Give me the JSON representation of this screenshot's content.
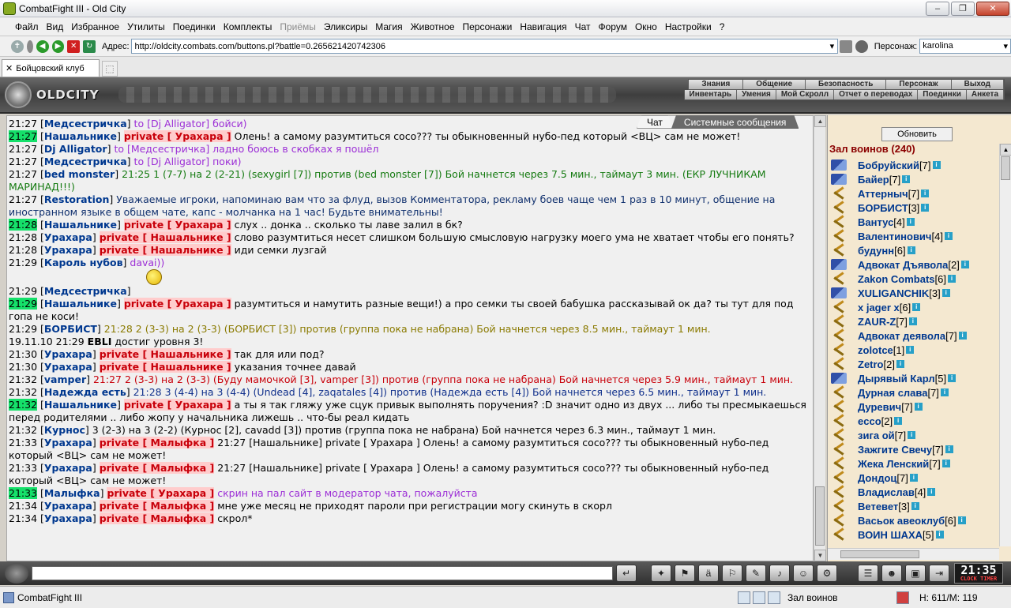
{
  "window": {
    "title": "CombatFight III - Old City"
  },
  "menu": [
    "Файл",
    "Вид",
    "Избранное",
    "Утилиты",
    "Поединки",
    "Комплекты",
    "Приёмы",
    "Эликсиры",
    "Магия",
    "Животное",
    "Персонажи",
    "Навигация",
    "Чат",
    "Форум",
    "Окно",
    "Настройки",
    "?"
  ],
  "menu_disabled_index": 6,
  "address": {
    "label": "Адрес:",
    "url": "http://oldcity.combats.com/buttons.pl?battle=0.265621420742306",
    "persona_label": "Персонаж:",
    "persona": "karolina"
  },
  "tab": {
    "label": "Бойцовский клуб"
  },
  "logo": {
    "text": "OLDCITY"
  },
  "topnav1": [
    "Знания",
    "Общение",
    "Безопасность",
    "Персонаж",
    "Выход"
  ],
  "topnav2": [
    "Инвентарь",
    "Умения",
    "Мой Скролл",
    "Отчет о переводах",
    "Поединки",
    "Анкета"
  ],
  "chat_tabs": {
    "active": "Чат",
    "other": "Системные сообщения"
  },
  "chat": [
    {
      "time": "21:27",
      "hl": false,
      "nick": "Медсестричка",
      "to": "to [Dj Alligator] бойси)"
    },
    {
      "time": "21:27",
      "hl": true,
      "nick": "Нашальнике",
      "priv": "private [ Урахара ]",
      "text": " Олень! а самому разумтиться сосо??? ты обыкновенный нубо-пед который <ВЦ> сам не может!"
    },
    {
      "time": "21:27",
      "hl": false,
      "nick": "Dj Alligator",
      "to": "to [Медсестричка] ладно боюсь в скобках я пошёл"
    },
    {
      "time": "21:27",
      "hl": false,
      "nick": "Медсестричка",
      "to": "to [Dj Alligator] поки)"
    },
    {
      "time": "21:27",
      "hl": false,
      "nick": "bed monster",
      "sys": "21:25 1 (7-7) на 2 (2-21) (sexygirl [7]) против (bed monster [7]) Бой начнется через 7.5 мин., таймаут 3 мин. (ЕКР ЛУЧНИКАМ МАРИНАД!!!)"
    },
    {
      "time": "21:27",
      "hl": false,
      "nick": "Restoration",
      "info": " Уважаемые игроки, напоминаю вам что за флуд, вызов Комментатора, рекламу боев чаще чем 1 раз в 10 минут, общение на иностранном языке в общем чате, капс - молчанка на 1 час! Будьте внимательны!"
    },
    {
      "time": "21:28",
      "hl": true,
      "nick": "Нашальнике",
      "priv": "private [ Урахара ]",
      "text": " слух .. донка .. сколько ты лаве залил в бк?"
    },
    {
      "time": "21:28",
      "hl": false,
      "nick": "Урахара",
      "priv": "private [ Нашальнике ]",
      "text": " слово разумтиться несет слишком большую смысловую нагрузку моего ума не хватает чтобы его понять?"
    },
    {
      "time": "21:28",
      "hl": false,
      "nick": "Урахара",
      "priv": "private [ Нашальнике ]",
      "text": " иди семки лузгай"
    },
    {
      "time": "21:29",
      "hl": false,
      "nick": "Кароль нубов",
      "to": "davai))",
      "smiley": true
    },
    {
      "time": "21:29",
      "hl": false,
      "nick": "Медсестричка",
      "text": " "
    },
    {
      "time": "21:29",
      "hl": true,
      "nick": "Нашальнике",
      "priv": "private [ Урахара ]",
      "text": " разумтиться и намутить разные вещи!) а про семки ты своей бабушка рассказывай ок да? ты тут для под гопа не коси!"
    },
    {
      "time": "21:29",
      "hl": false,
      "nick": "БОРБИСТ",
      "sys2": "21:28 2 (3-3) на 2 (3-3) (БОРБИСТ [3]) против (группа пока не набрана) Бой начнется через 8.5 мин., таймаут 1 мин."
    },
    {
      "time": "19.11.10  21:29",
      "hl": false,
      "plain": "EBLI",
      "text": " достиг уровня 3!"
    },
    {
      "time": "21:30",
      "hl": false,
      "nick": "Урахара",
      "priv": "private [ Нашальнике ]",
      "text": " так для или под?"
    },
    {
      "time": "21:30",
      "hl": false,
      "nick": "Урахара",
      "priv": "private [ Нашальнике ]",
      "text": " указания точнее давай"
    },
    {
      "time": "21:32",
      "hl": false,
      "nick": "vamper",
      "sys3": "21:27 2 (3-3) на 2 (3-3) (Буду мамочкой [3], vamper [3]) против (группа пока не набрана) Бой начнется через 5.9 мин., таймаут 1 мин."
    },
    {
      "time": "21:32",
      "hl": false,
      "nick": "Надежда есть",
      "sys4": "21:28 3 (4-4) на 3 (4-4) (Undead [4], zaqatales [4]) против (Надежда есть [4]) Бой начнется через 6.5 мин., таймаут 1 мин."
    },
    {
      "time": "21:32",
      "hl": true,
      "nick": "Нашальнике",
      "priv": "private [ Урахара ]",
      "text": " а ты я так гляжу уже сцук привык выполнять поручения? :D значит одно из двух ... либо ты пресмыкаешься перед родителями .. либо жопу у начальника лижешь .. что-бы реал кидать"
    },
    {
      "time": "21:32",
      "hl": false,
      "nick": "Курнос",
      "text": " 3 (2-3) на 3 (2-2) (Курнос [2], cavadd [3]) против (группа пока не набрана) Бой начнется через 6.3 мин., таймаут 1 мин."
    },
    {
      "time": "21:33",
      "hl": false,
      "nick": "Урахара",
      "priv": "private [ Малыфка ]",
      "text": " 21:27 [Нашальнике] private [ Урахара ] Олень! а самому разумтиться сосо??? ты обыкновенный нубо-пед который <ВЦ> сам не может!"
    },
    {
      "time": "21:33",
      "hl": false,
      "nick": "Урахара",
      "priv": "private [ Малыфка ]",
      "text": " 21:27 [Нашальнике] private [ Урахара ] Олень! а самому разумтиться сосо??? ты обыкновенный нубо-пед который <ВЦ> сам не может!"
    },
    {
      "time": "21:33",
      "hl": true,
      "nick": "Малыфка",
      "priv": "private [ Урахара ]",
      "to": "скрин на пал сайт в модератор чата, пожалуйста"
    },
    {
      "time": "21:34",
      "hl": false,
      "nick": "Урахара",
      "priv": "private [ Малыфка ]",
      "text": " мне уже месяц не приходят пароли при регистрации могу скинуть в скорл"
    },
    {
      "time": "21:34",
      "hl": false,
      "nick": "Урахара",
      "priv": "private [ Малыфка ]",
      "text": " скрол*"
    }
  ],
  "right_panel": {
    "refresh": "Обновить",
    "hall": "Зал воинов (240)",
    "players": [
      {
        "icon": "mod",
        "name": "Бобруйский",
        "lvl": "[7]"
      },
      {
        "icon": "mod",
        "name": "Байер",
        "lvl": "[7]"
      },
      {
        "icon": "fight",
        "name": "Аттерныч",
        "lvl": "[7]"
      },
      {
        "icon": "fight",
        "name": "БОРБИСТ",
        "lvl": "[3]"
      },
      {
        "icon": "fight",
        "name": "Вантус",
        "lvl": "[4]"
      },
      {
        "icon": "fight",
        "name": "Валентинович",
        "lvl": "[4]"
      },
      {
        "icon": "fight",
        "name": "будунн",
        "lvl": "[6]"
      },
      {
        "icon": "mod",
        "name": "Адвокат Дъявола",
        "lvl": "[2]"
      },
      {
        "icon": "fight",
        "name": "Zakon Combats",
        "lvl": "[6]"
      },
      {
        "icon": "mod",
        "name": "XULIGANCHIK",
        "lvl": "[3]"
      },
      {
        "icon": "fight",
        "name": "x jager x",
        "lvl": "[6]"
      },
      {
        "icon": "fight",
        "name": "ZAUR-Z",
        "lvl": "[7]"
      },
      {
        "icon": "fight",
        "name": "Адвокат деявола",
        "lvl": "[7]"
      },
      {
        "icon": "fight",
        "name": "zolotce",
        "lvl": "[1]"
      },
      {
        "icon": "fight",
        "name": "Zetro",
        "lvl": "[2]"
      },
      {
        "icon": "mod",
        "name": "Дырявый Карл",
        "lvl": "[5]"
      },
      {
        "icon": "fight",
        "name": "Дурная слава",
        "lvl": "[7]"
      },
      {
        "icon": "fight",
        "name": "Дуревич",
        "lvl": "[7]"
      },
      {
        "icon": "fight",
        "name": "ecco",
        "lvl": "[2]"
      },
      {
        "icon": "fight",
        "name": "зига ой",
        "lvl": "[7]"
      },
      {
        "icon": "fight",
        "name": "Зажгите Свечу",
        "lvl": "[7]"
      },
      {
        "icon": "fight",
        "name": "Жека Ленский",
        "lvl": "[7]"
      },
      {
        "icon": "fight",
        "name": "Дондоц",
        "lvl": "[7]"
      },
      {
        "icon": "fight",
        "name": "Владислав",
        "lvl": "[4]"
      },
      {
        "icon": "fight",
        "name": "Ветевет",
        "lvl": "[3]"
      },
      {
        "icon": "fight",
        "name": "Васьок авеоклуб",
        "lvl": "[6]"
      },
      {
        "icon": "fight",
        "name": "ВОИН ШАХА",
        "lvl": "[5]"
      }
    ]
  },
  "clock": {
    "time": "21:35",
    "label_a": "CLOCK",
    "label_b": "TIMER"
  },
  "status": {
    "app": "CombatFight III",
    "location": "Зал воинов",
    "hp": "H: 611/M: 119"
  }
}
